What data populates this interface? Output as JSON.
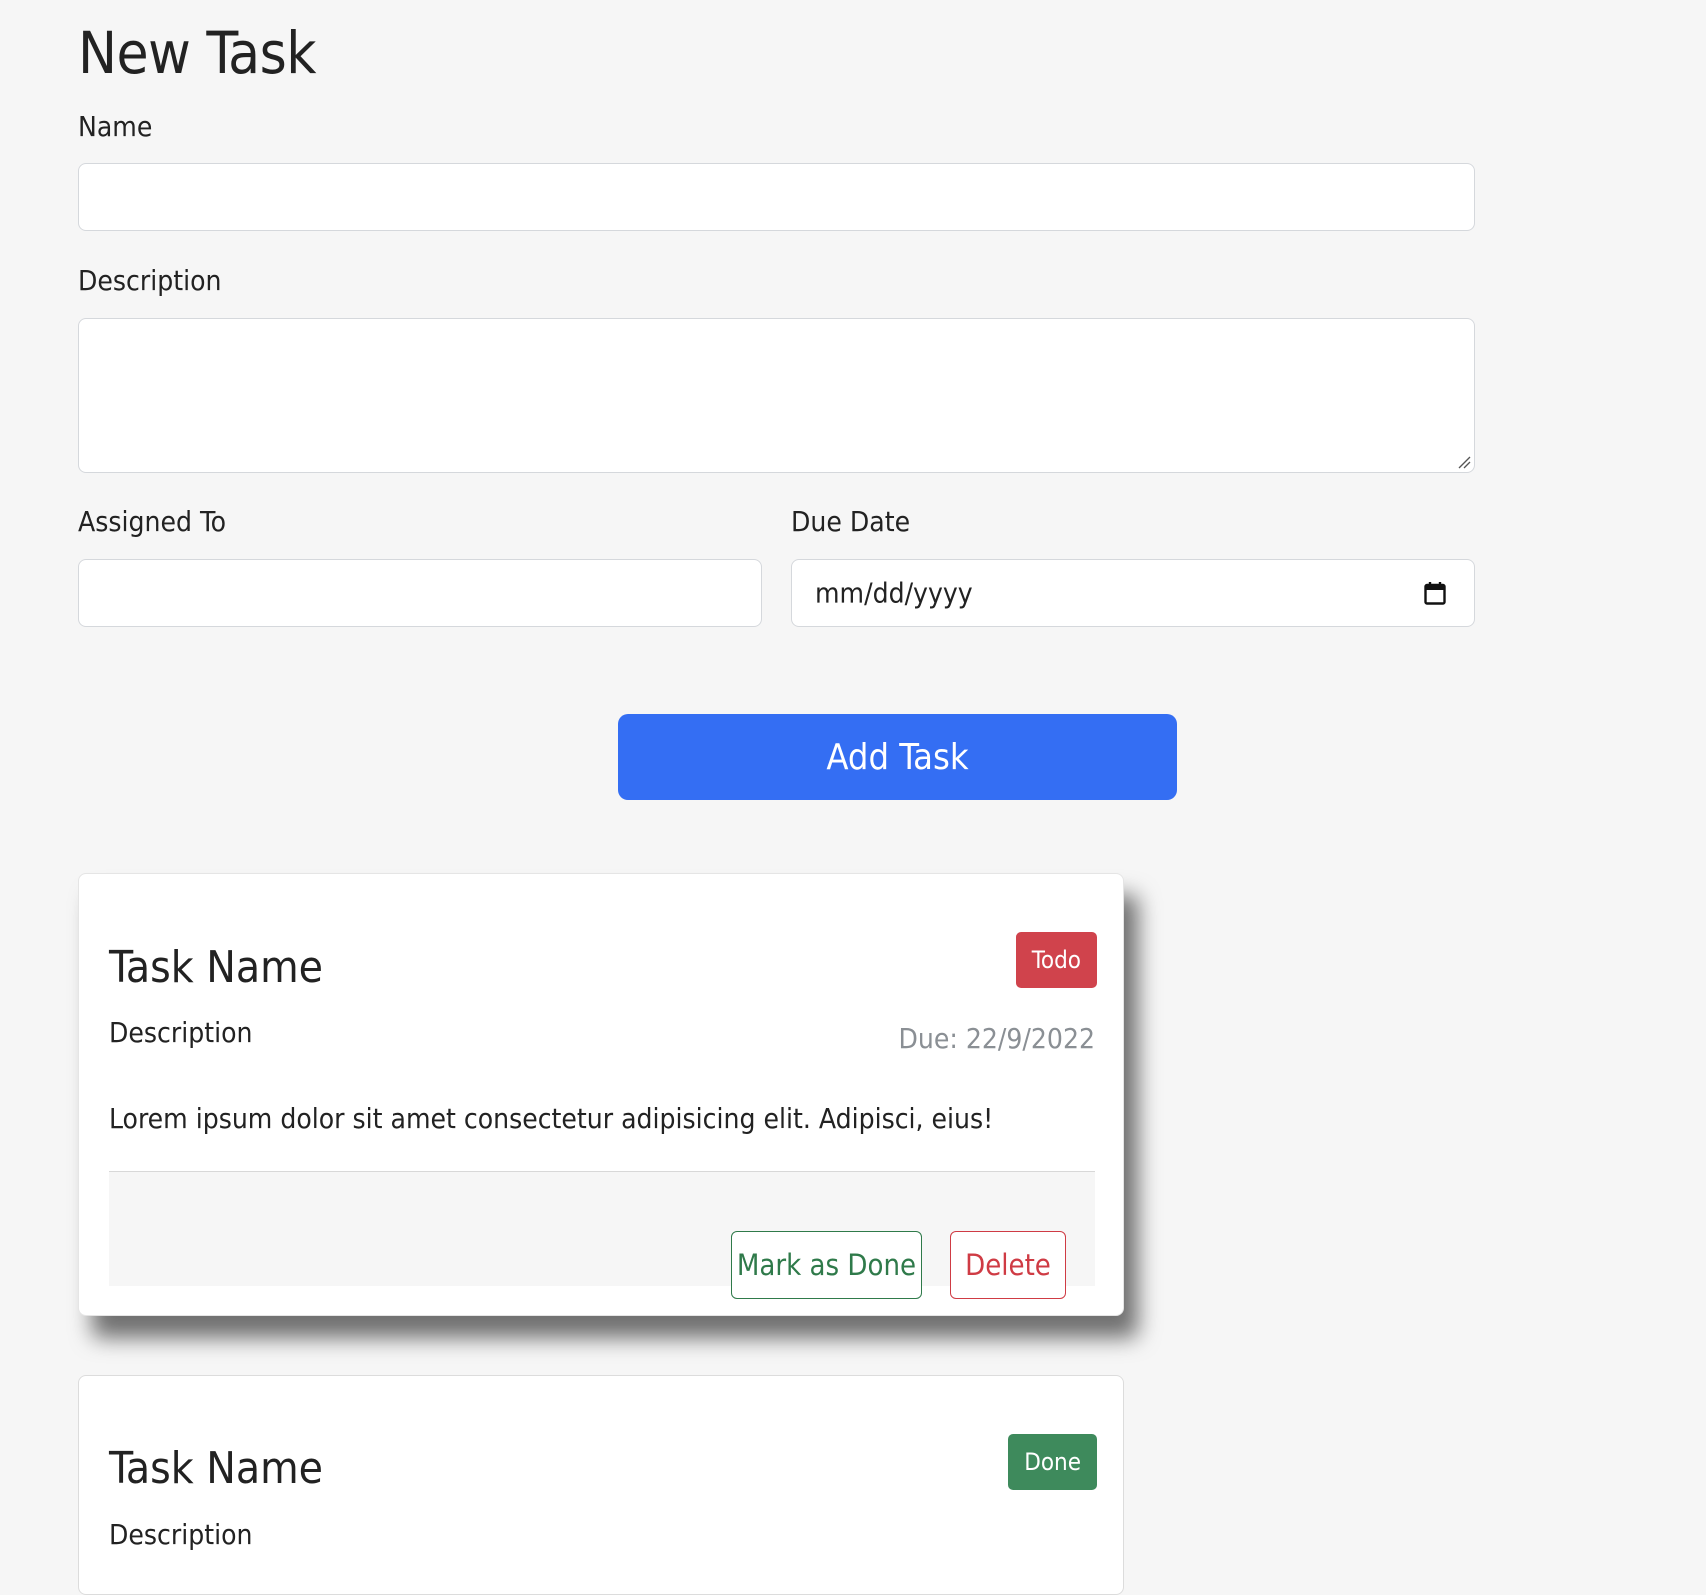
{
  "form": {
    "title": "New Task",
    "name_label": "Name",
    "name_value": "",
    "description_label": "Description",
    "description_value": "",
    "assigned_label": "Assigned To",
    "assigned_value": "",
    "due_label": "Due Date",
    "due_placeholder": "mm/dd/yyyy",
    "submit_label": "Add Task"
  },
  "tasks": [
    {
      "title": "Task Name",
      "status": "Todo",
      "subtitle": "Description",
      "due": "Due: 22/9/2022",
      "text": "Lorem ipsum dolor sit amet consectetur adipisicing elit. Adipisci, eius!",
      "done_label": "Mark as Done",
      "delete_label": "Delete"
    },
    {
      "title": "Task Name",
      "status": "Done",
      "subtitle": "Description"
    }
  ],
  "colors": {
    "primary": "#346ef3",
    "todo": "#d0434c",
    "done": "#3e8a5c"
  }
}
